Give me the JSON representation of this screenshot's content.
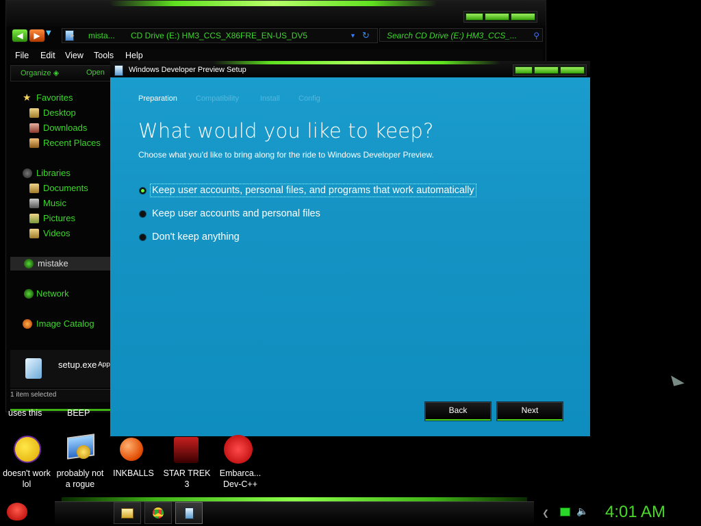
{
  "explorer": {
    "address_parts": [
      "mista...",
      "CD Drive (E:) HM3_CCS_X86FRE_EN-US_DV5"
    ],
    "search_placeholder": "Search CD Drive (E:) HM3_CCS_...",
    "menu": [
      "File",
      "Edit",
      "View",
      "Tools",
      "Help"
    ],
    "commands": {
      "organize": "Organize",
      "open": "Open"
    },
    "nav": {
      "favorites": "Favorites",
      "favorite_items": [
        "Desktop",
        "Downloads",
        "Recent Places"
      ],
      "libraries": "Libraries",
      "library_items": [
        "Documents",
        "Music",
        "Pictures",
        "Videos"
      ],
      "homegroup": "mistake",
      "network": "Network",
      "image_catalog": "Image Catalog"
    },
    "details": {
      "name": "setup.exe",
      "type": "App"
    },
    "status": "1 item selected"
  },
  "setup": {
    "title": "Windows Developer Preview Setup",
    "steps": [
      "Preparation",
      "Compatibility",
      "Install",
      "Config"
    ],
    "active_step": "Preparation",
    "heading": "What would you like to keep?",
    "subheading": "Choose what you'd like to bring along for the ride to Windows Developer Preview.",
    "options": [
      "Keep user accounts, personal files, and programs that work automatically",
      "Keep user accounts and personal files",
      "Don't keep anything"
    ],
    "selected_option": 0,
    "buttons": {
      "back": "Back",
      "next": "Next"
    }
  },
  "desktop": {
    "partial_labels": [
      "uses this",
      "BEEP"
    ],
    "icons": [
      {
        "label_line1": "doesn't work",
        "label_line2": "lol",
        "icon": "yahoo-messenger-icon"
      },
      {
        "label_line1": "probably not",
        "label_line2": "a rogue",
        "icon": "gear-monitor-icon"
      },
      {
        "label_line1": "INKBALLS",
        "label_line2": "",
        "icon": "inkball-icon"
      },
      {
        "label_line1": "STAR TREK",
        "label_line2": "3",
        "icon": "star-trek-icon"
      },
      {
        "label_line1": "Embarca...",
        "label_line2": "Dev-C++",
        "icon": "dev-cpp-icon"
      }
    ]
  },
  "taskbar": {
    "clock": "4:01 AM",
    "pinned": [
      "explorer-folder-icon",
      "chrome-icon",
      "setup-app-icon"
    ]
  },
  "colors": {
    "accent_green": "#3cd82b",
    "setup_blue": "#1594c4",
    "caption_green": "#5fe11f"
  }
}
